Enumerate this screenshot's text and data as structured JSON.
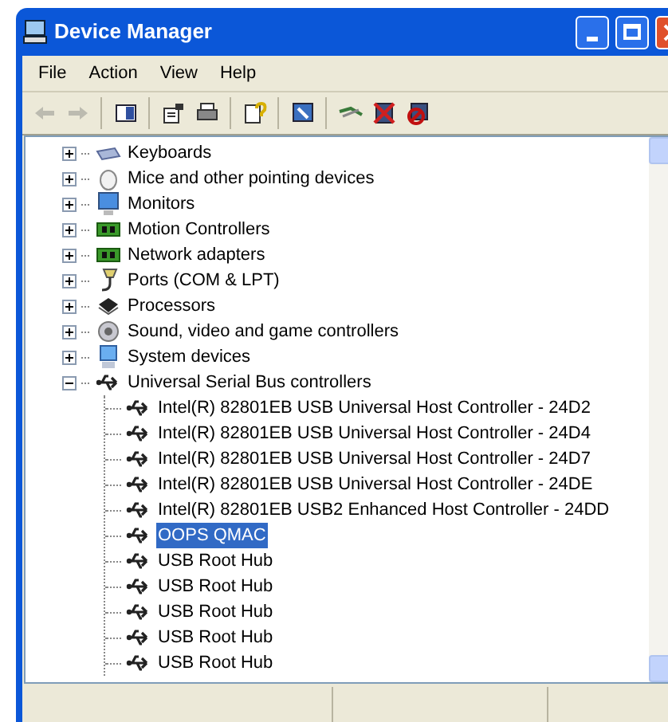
{
  "window": {
    "title": "Device Manager"
  },
  "menu": [
    "File",
    "Action",
    "View",
    "Help"
  ],
  "toolbar": [
    {
      "disabled": true
    },
    {
      "disabled": true
    },
    {
      "disabled": false
    },
    {
      "disabled": false
    },
    {
      "disabled": false
    },
    {
      "disabled": false
    },
    {
      "disabled": false
    },
    {
      "disabled": false
    },
    {
      "disabled": false
    },
    {
      "disabled": false
    }
  ],
  "tree": [
    {
      "label": "Keyboards",
      "expanded": false
    },
    {
      "label": "Mice and other pointing devices",
      "expanded": false
    },
    {
      "label": "Monitors",
      "expanded": false
    },
    {
      "label": "Motion Controllers",
      "expanded": false
    },
    {
      "label": "Network adapters",
      "expanded": false
    },
    {
      "label": "Ports (COM & LPT)",
      "expanded": false
    },
    {
      "label": "Processors",
      "expanded": false
    },
    {
      "label": "Sound, video and game controllers",
      "expanded": false
    },
    {
      "label": "System devices",
      "expanded": false
    },
    {
      "label": "Universal Serial Bus controllers",
      "expanded": true,
      "children": [
        {
          "label": "Intel(R) 82801EB USB Universal Host Controller - 24D2",
          "selected": false
        },
        {
          "label": "Intel(R) 82801EB USB Universal Host Controller - 24D4",
          "selected": false
        },
        {
          "label": "Intel(R) 82801EB USB Universal Host Controller - 24D7",
          "selected": false
        },
        {
          "label": "Intel(R) 82801EB USB Universal Host Controller - 24DE",
          "selected": false
        },
        {
          "label": "Intel(R) 82801EB USB2 Enhanced Host Controller - 24DD",
          "selected": false
        },
        {
          "label": "OOPS QMAC",
          "selected": true
        },
        {
          "label": "USB Root Hub",
          "selected": false
        },
        {
          "label": "USB Root Hub",
          "selected": false
        },
        {
          "label": "USB Root Hub",
          "selected": false
        },
        {
          "label": "USB Root Hub",
          "selected": false
        },
        {
          "label": "USB Root Hub",
          "selected": false
        }
      ]
    }
  ]
}
